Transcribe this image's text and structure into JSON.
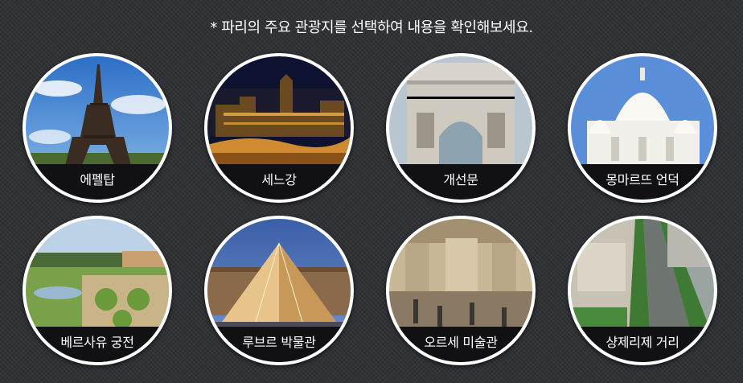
{
  "notice": "* 파리의 주요 관광지를 선택하여 내용을 확인해보세요.",
  "spots": [
    {
      "label": "에펠탑"
    },
    {
      "label": "세느강"
    },
    {
      "label": "개선문"
    },
    {
      "label": "몽마르뜨 언덕"
    },
    {
      "label": "베르사유 궁전"
    },
    {
      "label": "루브르 박물관"
    },
    {
      "label": "오르세 미술관"
    },
    {
      "label": "샹제리제 거리"
    }
  ]
}
